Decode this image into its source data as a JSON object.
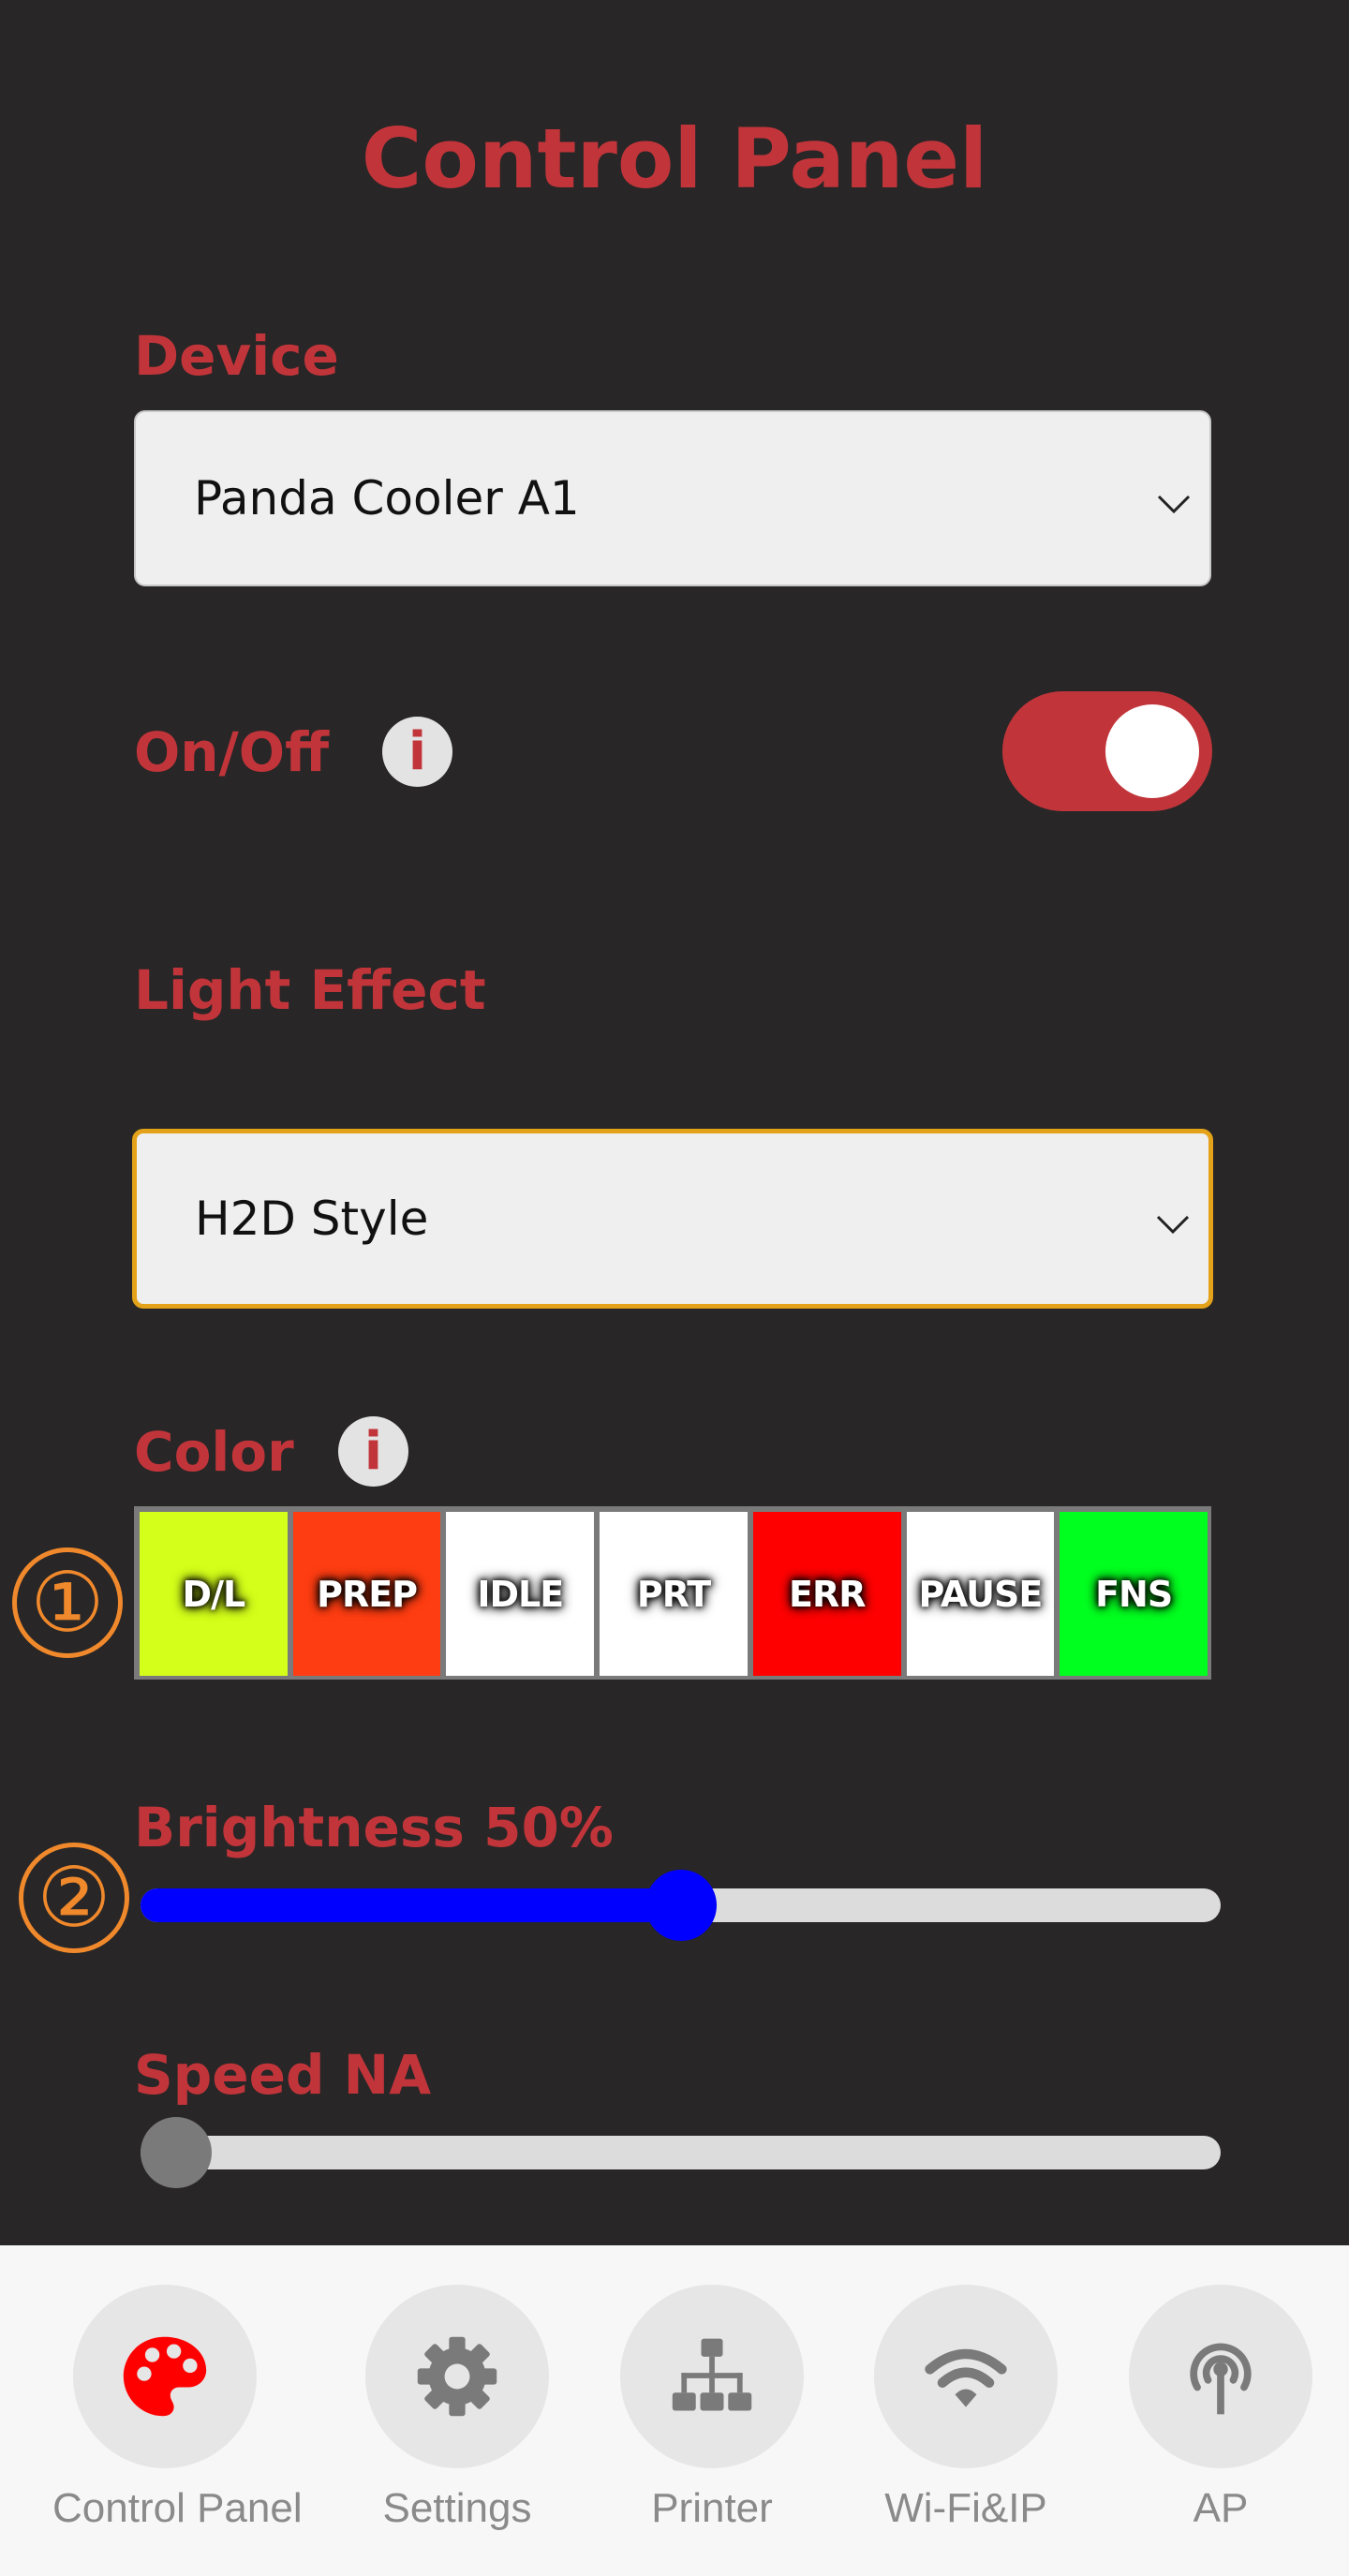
{
  "page": {
    "title": "Control Panel"
  },
  "device": {
    "label": "Device",
    "selected": "Panda Cooler A1"
  },
  "power": {
    "label": "On/Off",
    "info_icon": "i",
    "on": true
  },
  "light_effect": {
    "label": "Light Effect",
    "selected": "H2D Style"
  },
  "color": {
    "label": "Color",
    "info_icon": "i",
    "marker": "①",
    "swatches": [
      {
        "label": "D/L",
        "color": "#d4ff1a"
      },
      {
        "label": "PREP",
        "color": "#ff3d12"
      },
      {
        "label": "IDLE",
        "color": "#ffffff"
      },
      {
        "label": "PRT",
        "color": "#ffffff"
      },
      {
        "label": "ERR",
        "color": "#ff0000"
      },
      {
        "label": "PAUSE",
        "color": "#ffffff"
      },
      {
        "label": "FNS",
        "color": "#00ff1f"
      }
    ]
  },
  "brightness": {
    "label": "Brightness 50%",
    "value": 50,
    "marker": "②",
    "color": "#0000ff"
  },
  "speed": {
    "label": "Speed NA",
    "value": 0
  },
  "nav": {
    "items": [
      {
        "label": "Control Panel",
        "icon": "palette-icon",
        "active": true
      },
      {
        "label": "Settings",
        "icon": "gear-icon"
      },
      {
        "label": "Printer",
        "icon": "network-icon"
      },
      {
        "label": "Wi-Fi&IP",
        "icon": "wifi-icon"
      },
      {
        "label": "AP",
        "icon": "antenna-icon"
      }
    ]
  },
  "colors": {
    "accent": "#c1353a",
    "focus": "#e3a21a",
    "marker": "#f0892c",
    "background": "#282627"
  }
}
